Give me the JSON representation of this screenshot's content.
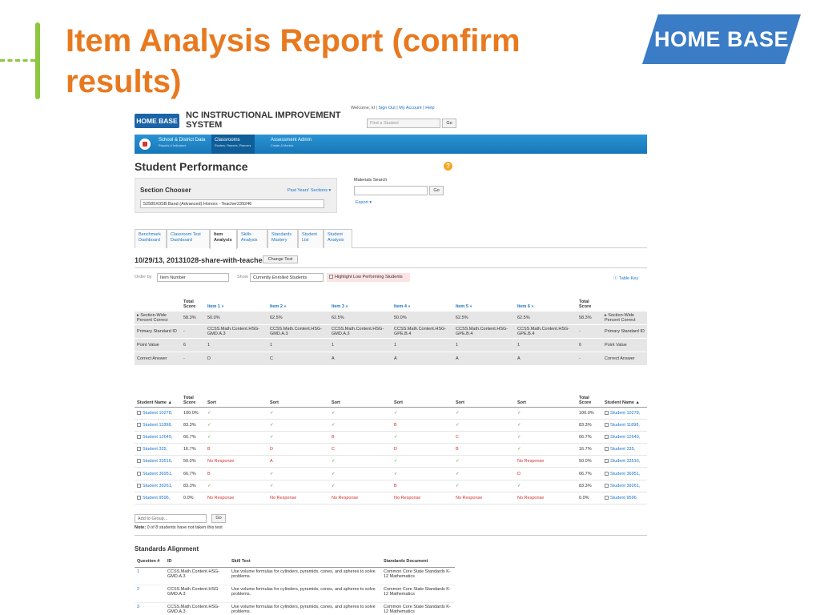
{
  "slide": {
    "title": "Item Analysis Report (confirm results)",
    "logo_text": "HOME BASE",
    "accent_color": "#e8791f",
    "deco_color": "#8dc63f"
  },
  "app": {
    "logo": "HOME BASE",
    "system_title": "NC INSTRUCTIONAL IMPROVEMENT SYSTEM",
    "welcome": "Welcome, kl",
    "links": [
      "Sign Out",
      "My Account",
      "Help"
    ],
    "find_placeholder": "Find a Student",
    "go": "Go",
    "nav": [
      {
        "label": "School & District Data",
        "sub": "Reports & Indicators"
      },
      {
        "label": "Classrooms",
        "sub": "Rosters, Reports, Planners"
      },
      {
        "label": "Assessment Admin",
        "sub": "Create & Monitor"
      }
    ]
  },
  "page": {
    "heading": "Student Performance",
    "section_chooser_label": "Section Chooser",
    "past_sections": "Past Years' Sections ▾",
    "section_value": "52585X0SB Band (Advanced) Honors - Teacher239246",
    "materials_search": "Materials Search",
    "export": "Export ▾",
    "tabs": [
      [
        "Benchmark",
        "Dashboard"
      ],
      [
        "Classroom Test",
        "Dashboard"
      ],
      [
        "Item",
        "Analysis"
      ],
      [
        "Skills",
        "Analysis"
      ],
      [
        "Standards",
        "Mastery"
      ],
      [
        "Student",
        "List"
      ],
      [
        "Student",
        "Analysis"
      ]
    ],
    "test_name": "10/29/13, 20131028-share-with-teacher316",
    "change_test": "Change Test",
    "order_by": "Order by",
    "order_value": "Item Number",
    "show": "Show",
    "show_value": "Currently Enrolled Students",
    "highlight": "Highlight Low Performing Students",
    "table_key": "Table Key"
  },
  "summary": {
    "headers": [
      "",
      "Total Score",
      "Item 1 »",
      "Item 2 »",
      "Item 3 »",
      "Item 4 »",
      "Item 5 »",
      "Item 6 »",
      "Total Score",
      ""
    ],
    "rows": [
      [
        "▸ Section-Wide Percent Correct",
        "58.3%",
        "50.0%",
        "62.5%",
        "62.5%",
        "50.0%",
        "62.5%",
        "62.5%",
        "58.3%",
        "▸ Section-Wide Percent Correct"
      ],
      [
        "Primary Standard ID",
        "-",
        "CCSS.Math.Content.HSG-GMD.A.3",
        "CCSS.Math.Content.HSG-GMD.A.3",
        "CCSS.Math.Content.HSG-GMD.A.3",
        "CCSS.Math.Content.HSG-GPE.B.4",
        "CCSS.Math.Content.HSG-GPE.B.4",
        "CCSS.Math.Content.HSG-GPE.B.4",
        "-",
        "Primary Standard ID"
      ],
      [
        "Point Value",
        "6",
        "1",
        "1",
        "1",
        "1",
        "1",
        "1",
        "6",
        "Point Value"
      ],
      [
        "Correct Answer",
        "-",
        "D",
        "C",
        "A",
        "A",
        "A",
        "A",
        "-",
        "Correct Answer"
      ]
    ]
  },
  "students": {
    "headers": [
      "Student Name ▲",
      "Total Score",
      "Sort",
      "Sort",
      "Sort",
      "Sort",
      "Sort",
      "Sort",
      "Total Score",
      "Student Name ▲"
    ],
    "rows": [
      {
        "name": "Student 10278,",
        "score": "100.0%",
        "items": [
          "✓",
          "✓",
          "✓",
          "✓",
          "✓",
          "✓"
        ]
      },
      {
        "name": "Student 11898,",
        "score": "83.3%",
        "items": [
          "✓",
          "✓",
          "✓",
          "B",
          "✓",
          "✓"
        ]
      },
      {
        "name": "Student 12649,",
        "score": "66.7%",
        "items": [
          "✓",
          "✓",
          "B",
          "✓",
          "C",
          "✓"
        ]
      },
      {
        "name": "Student 335,",
        "score": "16.7%",
        "items": [
          "B",
          "D",
          "C",
          "D",
          "B",
          "✓"
        ]
      },
      {
        "name": "Student 33516,",
        "score": "50.0%",
        "items": [
          "No Response",
          "A",
          "✓",
          "✓",
          "✓",
          "No Response"
        ]
      },
      {
        "name": "Student 36951,",
        "score": "66.7%",
        "items": [
          "B",
          "✓",
          "✓",
          "✓",
          "✓",
          "D"
        ]
      },
      {
        "name": "Student 39261,",
        "score": "83.3%",
        "items": [
          "✓",
          "✓",
          "✓",
          "B",
          "✓",
          "✓"
        ]
      },
      {
        "name": "Student 9596,",
        "score": "0.0%",
        "items": [
          "No Response",
          "No Response",
          "No Response",
          "No Response",
          "No Response",
          "No Response"
        ]
      }
    ],
    "add_to_group": "Add to Group...",
    "note_label": "Note:",
    "note": "0 of 8 students have not taken this test"
  },
  "standards": {
    "title": "Standards Alignment",
    "headers": [
      "Question #",
      "ID",
      "Skill Text",
      "Standards Document"
    ],
    "rows": [
      [
        "1",
        "CCSS.Math.Content.HSG-GMD.A.3",
        "Use volume formulas for cylinders, pyramids, cones, and spheres to solve problems.",
        "Common Core State Standards K-12 Mathematics"
      ],
      [
        "2",
        "CCSS.Math.Content.HSG-GMD.A.3",
        "Use volume formulas for cylinders, pyramids, cones, and spheres to solve problems.",
        "Common Core State Standards K-12 Mathematics"
      ],
      [
        "3",
        "CCSS.Math.Content.HSG-GMD.A.3",
        "Use volume formulas for cylinders, pyramids, cones, and spheres to solve problems.",
        "Common Core State Standards K-12 Mathematics"
      ]
    ]
  }
}
